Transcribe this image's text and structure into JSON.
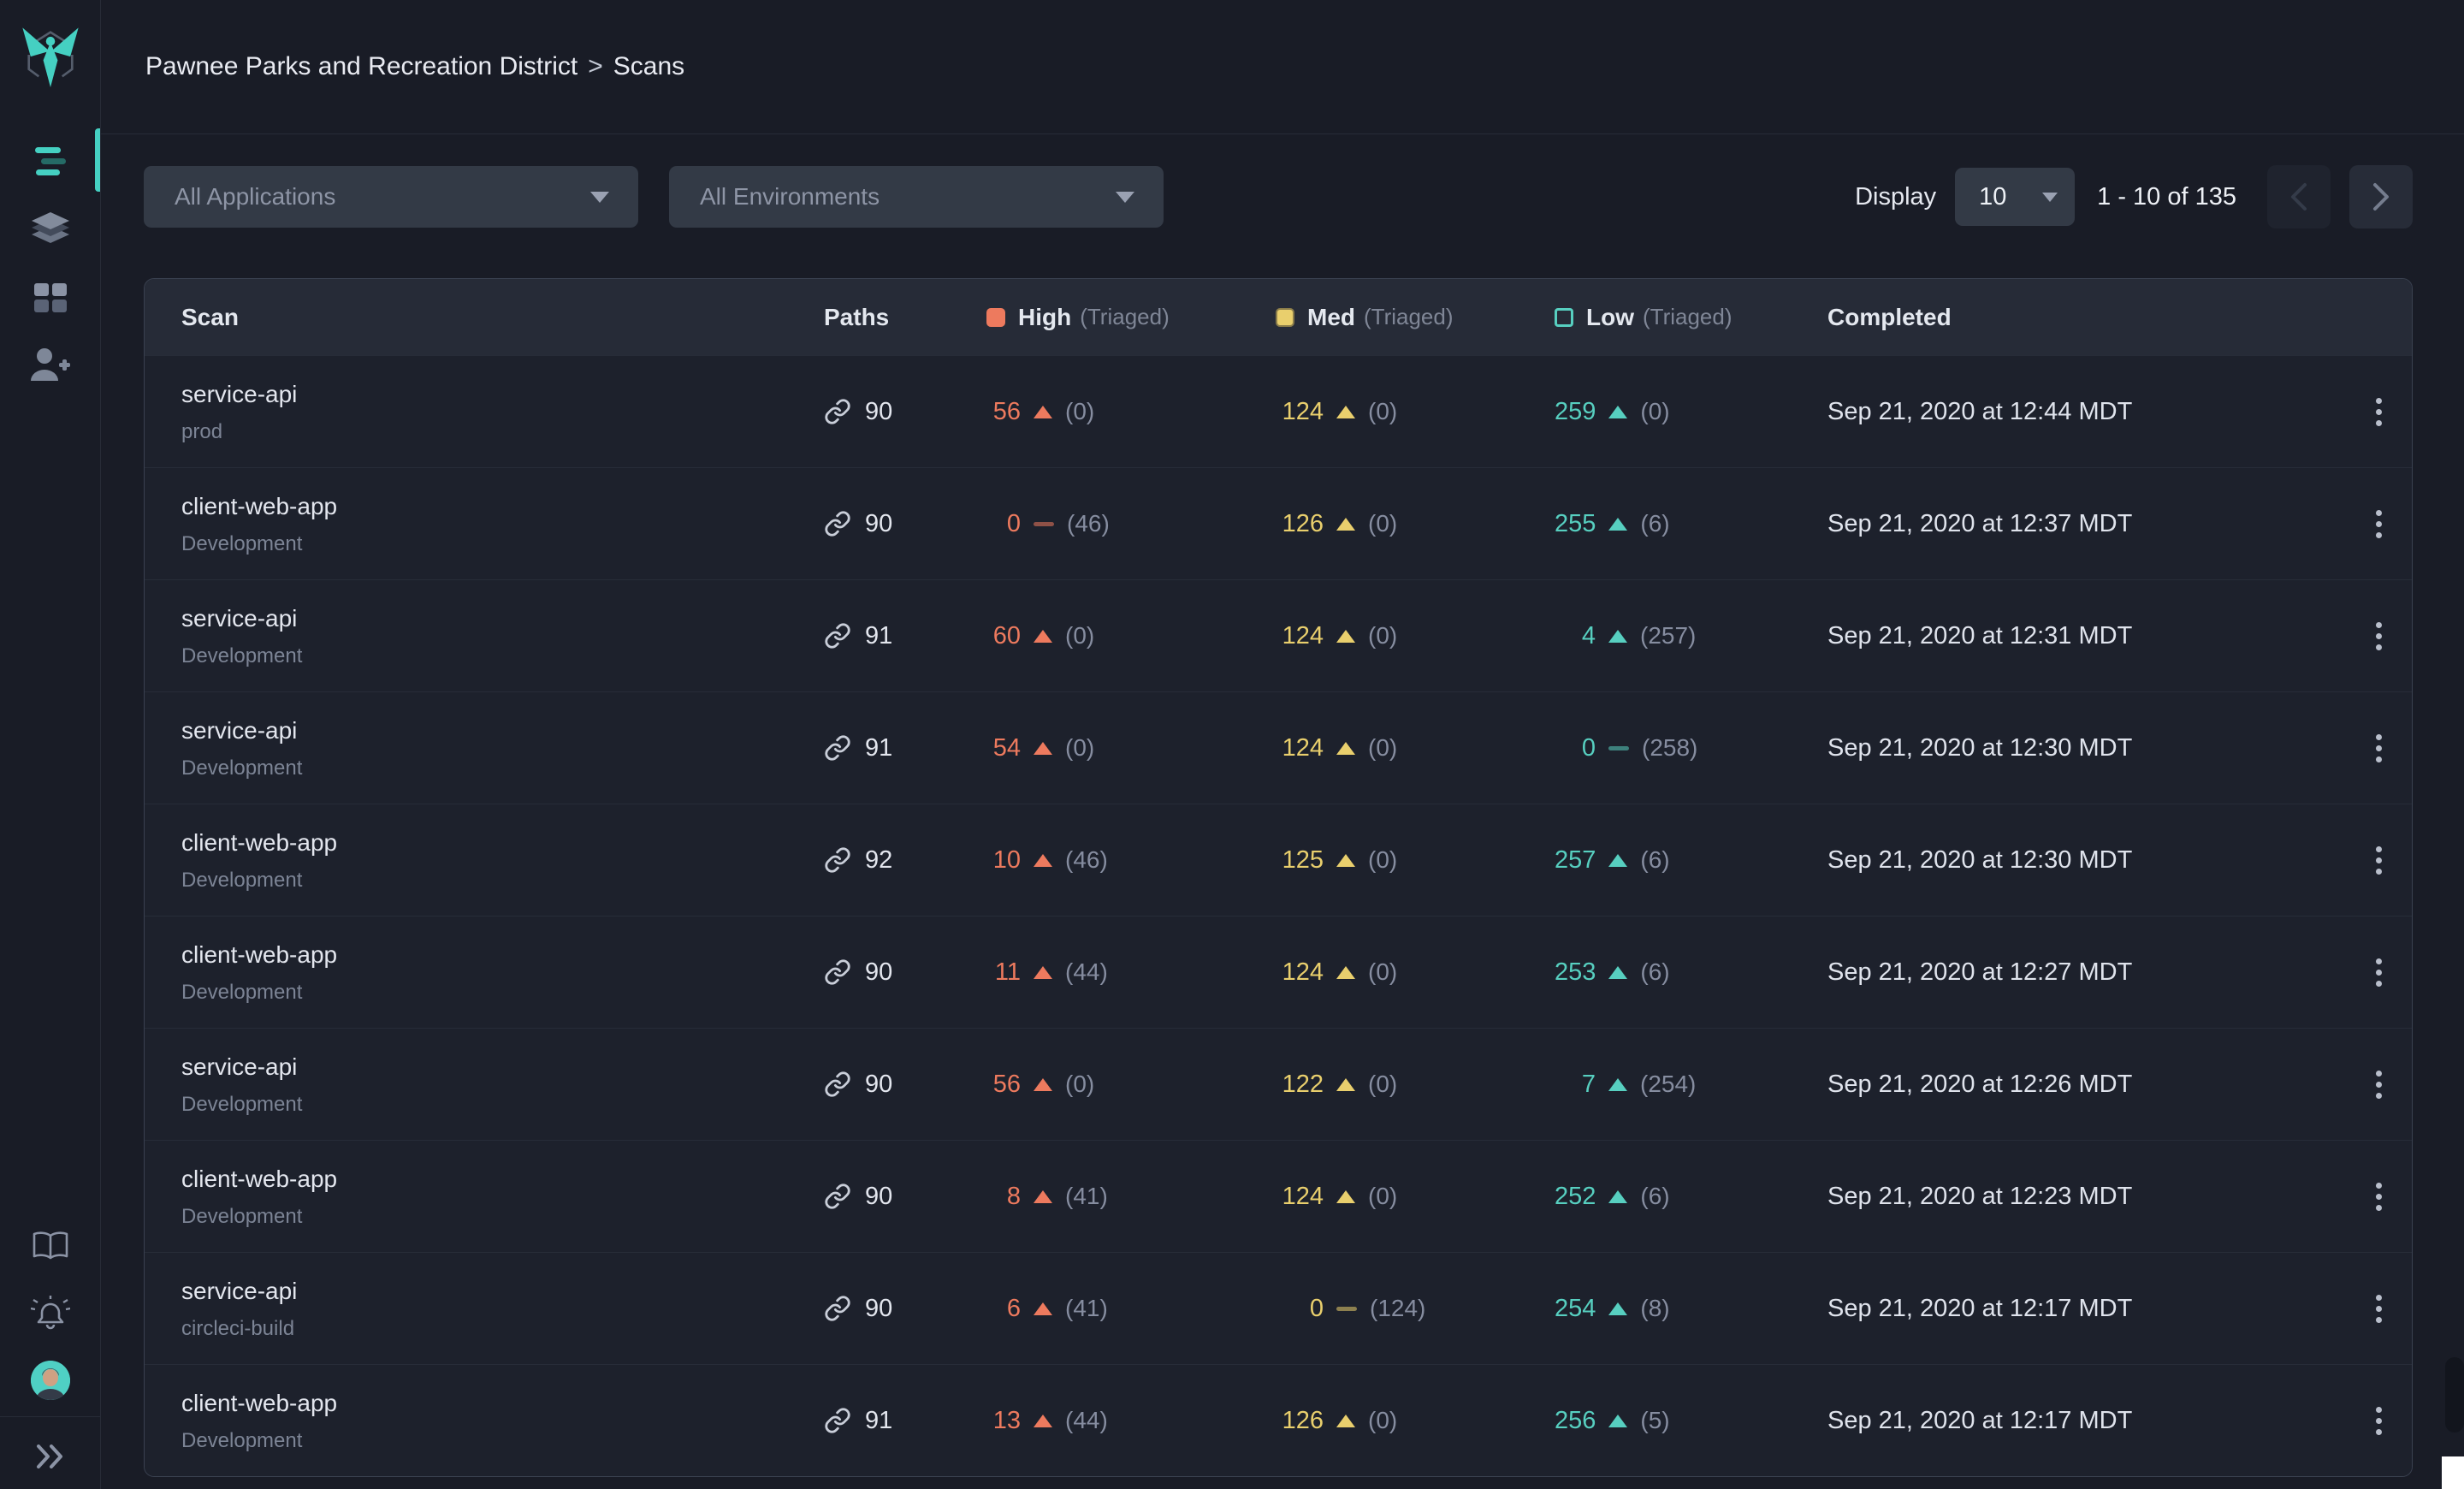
{
  "brand": {
    "accent": "#45d0c2",
    "logo": "hawk-logo"
  },
  "breadcrumb": {
    "org": "Pawnee Parks and Recreation District",
    "separator": ">",
    "page": "Scans"
  },
  "filters": {
    "applications_placeholder": "All Applications",
    "environments_placeholder": "All Environments"
  },
  "pagination": {
    "display_label": "Display",
    "page_size": "10",
    "range": "1 - 10 of 135",
    "prev_icon": "chevron-left",
    "next_icon": "chevron-right"
  },
  "icons": {
    "dropdown_caret": "▼",
    "kebab": "⋮",
    "collapse": "»",
    "paths_link": "link-icon",
    "severity_up": "triangle-up",
    "severity_flat": "dash"
  },
  "table": {
    "headers": {
      "scan": "Scan",
      "paths": "Paths",
      "high": "High",
      "med": "Med",
      "low": "Low",
      "triaged": "(Triaged)",
      "completed": "Completed"
    },
    "severity_colors": {
      "high": "#ed7a5e",
      "med": "#e9cf6d",
      "low": "#57cfc0"
    },
    "rows": [
      {
        "name": "service-api",
        "env": "prod",
        "paths": "90",
        "high": {
          "count": "56",
          "dir": "up",
          "triaged": "(0)"
        },
        "med": {
          "count": "124",
          "dir": "up",
          "triaged": "(0)"
        },
        "low": {
          "count": "259",
          "dir": "up",
          "triaged": "(0)"
        },
        "completed": "Sep 21, 2020 at 12:44 MDT"
      },
      {
        "name": "client-web-app",
        "env": "Development",
        "paths": "90",
        "high": {
          "count": "0",
          "dir": "flat",
          "triaged": "(46)"
        },
        "med": {
          "count": "126",
          "dir": "up",
          "triaged": "(0)"
        },
        "low": {
          "count": "255",
          "dir": "up",
          "triaged": "(6)"
        },
        "completed": "Sep 21, 2020 at 12:37 MDT"
      },
      {
        "name": "service-api",
        "env": "Development",
        "paths": "91",
        "high": {
          "count": "60",
          "dir": "up",
          "triaged": "(0)"
        },
        "med": {
          "count": "124",
          "dir": "up",
          "triaged": "(0)"
        },
        "low": {
          "count": "4",
          "dir": "up",
          "triaged": "(257)"
        },
        "completed": "Sep 21, 2020 at 12:31 MDT"
      },
      {
        "name": "service-api",
        "env": "Development",
        "paths": "91",
        "high": {
          "count": "54",
          "dir": "up",
          "triaged": "(0)"
        },
        "med": {
          "count": "124",
          "dir": "up",
          "triaged": "(0)"
        },
        "low": {
          "count": "0",
          "dir": "flat",
          "triaged": "(258)"
        },
        "completed": "Sep 21, 2020 at 12:30 MDT"
      },
      {
        "name": "client-web-app",
        "env": "Development",
        "paths": "92",
        "high": {
          "count": "10",
          "dir": "up",
          "triaged": "(46)"
        },
        "med": {
          "count": "125",
          "dir": "up",
          "triaged": "(0)"
        },
        "low": {
          "count": "257",
          "dir": "up",
          "triaged": "(6)"
        },
        "completed": "Sep 21, 2020 at 12:30 MDT"
      },
      {
        "name": "client-web-app",
        "env": "Development",
        "paths": "90",
        "high": {
          "count": "11",
          "dir": "up",
          "triaged": "(44)"
        },
        "med": {
          "count": "124",
          "dir": "up",
          "triaged": "(0)"
        },
        "low": {
          "count": "253",
          "dir": "up",
          "triaged": "(6)"
        },
        "completed": "Sep 21, 2020 at 12:27 MDT"
      },
      {
        "name": "service-api",
        "env": "Development",
        "paths": "90",
        "high": {
          "count": "56",
          "dir": "up",
          "triaged": "(0)"
        },
        "med": {
          "count": "122",
          "dir": "up",
          "triaged": "(0)"
        },
        "low": {
          "count": "7",
          "dir": "up",
          "triaged": "(254)"
        },
        "completed": "Sep 21, 2020 at 12:26 MDT"
      },
      {
        "name": "client-web-app",
        "env": "Development",
        "paths": "90",
        "high": {
          "count": "8",
          "dir": "up",
          "triaged": "(41)"
        },
        "med": {
          "count": "124",
          "dir": "up",
          "triaged": "(0)"
        },
        "low": {
          "count": "252",
          "dir": "up",
          "triaged": "(6)"
        },
        "completed": "Sep 21, 2020 at 12:23 MDT"
      },
      {
        "name": "service-api",
        "env": "circleci-build",
        "paths": "90",
        "high": {
          "count": "6",
          "dir": "up",
          "triaged": "(41)"
        },
        "med": {
          "count": "0",
          "dir": "flat",
          "triaged": "(124)"
        },
        "low": {
          "count": "254",
          "dir": "up",
          "triaged": "(8)"
        },
        "completed": "Sep 21, 2020 at 12:17 MDT"
      },
      {
        "name": "client-web-app",
        "env": "Development",
        "paths": "91",
        "high": {
          "count": "13",
          "dir": "up",
          "triaged": "(44)"
        },
        "med": {
          "count": "126",
          "dir": "up",
          "triaged": "(0)"
        },
        "low": {
          "count": "256",
          "dir": "up",
          "triaged": "(5)"
        },
        "completed": "Sep 21, 2020 at 12:17 MDT"
      }
    ]
  }
}
